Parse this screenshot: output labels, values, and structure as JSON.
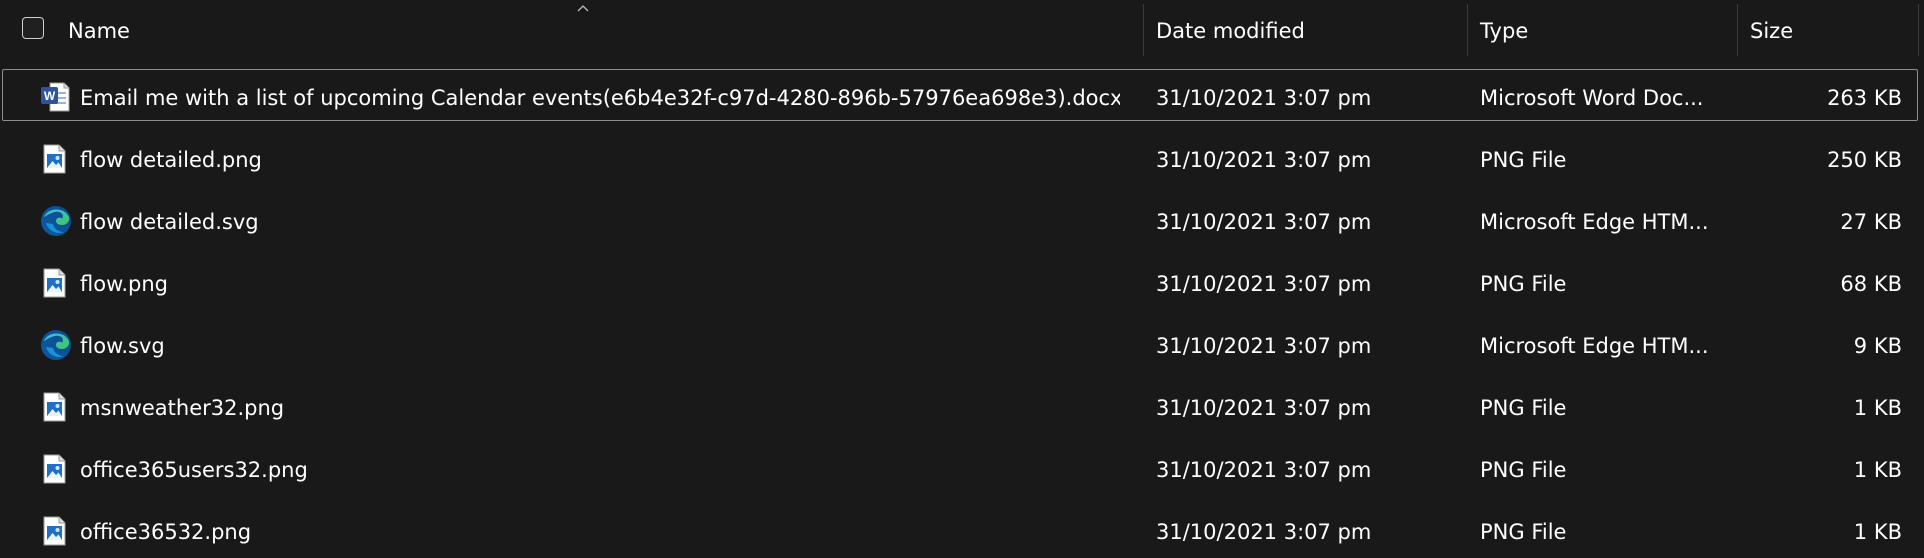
{
  "header": {
    "columns": {
      "name": "Name",
      "date_modified": "Date modified",
      "type": "Type",
      "size": "Size"
    },
    "sort_indicator": "ascending"
  },
  "files": [
    {
      "name": "Email me with a list of upcoming Calendar events(e6b4e32f-c97d-4280-896b-57976ea698e3).docx",
      "date": "31/10/2021 3:07 pm",
      "type": "Microsoft Word Doc...",
      "size": "263 KB",
      "icon": "word-document-icon",
      "selected": true
    },
    {
      "name": "flow detailed.png",
      "date": "31/10/2021 3:07 pm",
      "type": "PNG File",
      "size": "250 KB",
      "icon": "image-file-icon",
      "selected": false
    },
    {
      "name": "flow detailed.svg",
      "date": "31/10/2021 3:07 pm",
      "type": "Microsoft Edge HTM...",
      "size": "27 KB",
      "icon": "edge-icon",
      "selected": false
    },
    {
      "name": "flow.png",
      "date": "31/10/2021 3:07 pm",
      "type": "PNG File",
      "size": "68 KB",
      "icon": "image-file-icon",
      "selected": false
    },
    {
      "name": "flow.svg",
      "date": "31/10/2021 3:07 pm",
      "type": "Microsoft Edge HTM...",
      "size": "9 KB",
      "icon": "edge-icon",
      "selected": false
    },
    {
      "name": "msnweather32.png",
      "date": "31/10/2021 3:07 pm",
      "type": "PNG File",
      "size": "1 KB",
      "icon": "image-file-icon",
      "selected": false
    },
    {
      "name": "office365users32.png",
      "date": "31/10/2021 3:07 pm",
      "type": "PNG File",
      "size": "1 KB",
      "icon": "image-file-icon",
      "selected": false
    },
    {
      "name": "office36532.png",
      "date": "31/10/2021 3:07 pm",
      "type": "PNG File",
      "size": "1 KB",
      "icon": "image-file-icon",
      "selected": false
    }
  ],
  "colors": {
    "background": "#191919",
    "text": "#ffffff",
    "selection_border": "#8e8e8e",
    "word_blue": "#2b579a",
    "edge_blue": "#0c59a4",
    "edge_green": "#46c45d"
  }
}
